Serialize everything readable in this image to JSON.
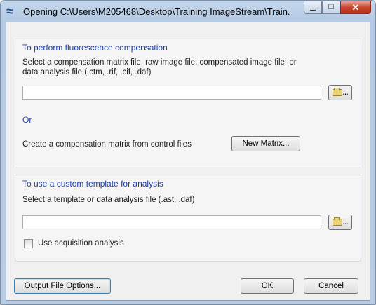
{
  "window": {
    "title": "Opening C:\\Users\\M205468\\Desktop\\Training ImageStream\\Train...",
    "icon": "app-wave-icon",
    "controls": {
      "minimize": "minimize-icon",
      "maximize": "maximize-icon",
      "close_glyph": "✕"
    }
  },
  "compensation": {
    "heading": "To perform fluorescence compensation",
    "instruction": "Select a compensation matrix file, raw image file, compensated image file, or data analysis file (.ctm, .rif, .cif, .daf)",
    "file_value": "",
    "browse_label": "...",
    "or_label": "Or",
    "create_text": "Create a compensation matrix from control files",
    "new_matrix_label": "New Matrix..."
  },
  "template": {
    "heading": "To use a custom template for analysis",
    "instruction": "Select a template or data analysis file (.ast, .daf)",
    "file_value": "",
    "browse_label": "...",
    "acquisition_label": "Use acquisition analysis",
    "acquisition_checked": false
  },
  "footer": {
    "output_options_label": "Output File Options...",
    "ok_label": "OK",
    "cancel_label": "Cancel"
  }
}
